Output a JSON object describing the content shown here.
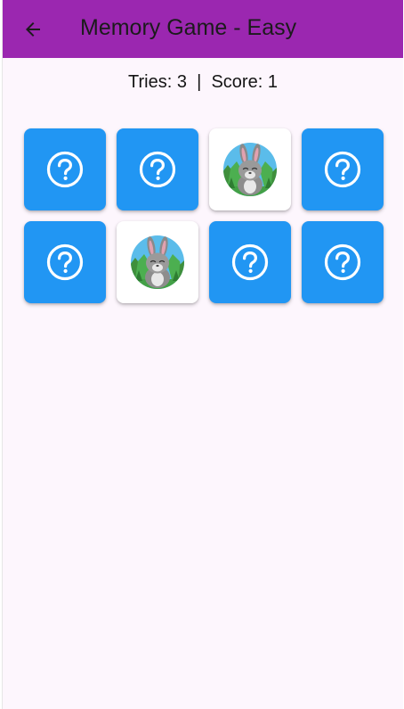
{
  "app_bar": {
    "title": "Memory Game - Easy",
    "back_icon": "arrow-left-icon"
  },
  "stats": {
    "tries_label": "Tries:",
    "tries": 3,
    "separator": "|",
    "score_label": "Score:",
    "score": 1
  },
  "cards": [
    {
      "state": "hidden",
      "icon": "help-circle-icon"
    },
    {
      "state": "hidden",
      "icon": "help-circle-icon"
    },
    {
      "state": "revealed",
      "icon": "rabbit-icon"
    },
    {
      "state": "hidden",
      "icon": "help-circle-icon"
    },
    {
      "state": "hidden",
      "icon": "help-circle-icon"
    },
    {
      "state": "revealed",
      "icon": "rabbit-icon"
    },
    {
      "state": "hidden",
      "icon": "help-circle-icon"
    },
    {
      "state": "hidden",
      "icon": "help-circle-icon"
    }
  ],
  "colors": {
    "app_bar": "#9b27b0",
    "background": "#fdf6fd",
    "card_hidden": "#2196f3",
    "card_revealed": "#ffffff"
  }
}
